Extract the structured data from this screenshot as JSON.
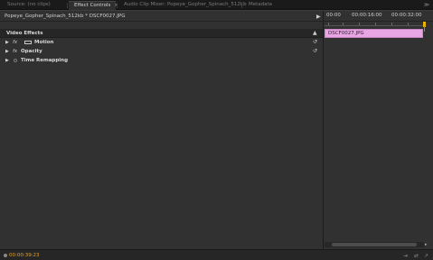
{
  "tabs": [
    {
      "label": "Source: (no clips)",
      "active": false
    },
    {
      "label": "Effect Controls",
      "active": true,
      "close": "×"
    },
    {
      "label": "Audio Clip Mixer: Popeye_Gopher_Spinach_512kb",
      "active": false
    },
    {
      "label": "Metadata",
      "active": false
    }
  ],
  "header": {
    "clip_name": "Popeye_Gopher_Spinach_512kb * DSCF0027.JPG"
  },
  "timeline": {
    "timecodes": [
      "00:00",
      "00:00:16:00",
      "00:00:32:00"
    ],
    "clip_label": "DSCF0027.JPG",
    "clip_color": "#e9a6e5",
    "playhead_color": "#e8b400"
  },
  "effects": {
    "section_title": "Video Effects",
    "items": [
      {
        "name": "Motion",
        "fx": "fx",
        "has_reset": true
      },
      {
        "name": "Opacity",
        "fx": "fx",
        "has_reset": true
      },
      {
        "name": "Time Remapping",
        "fx": "",
        "has_reset": false
      }
    ]
  },
  "footer": {
    "timecode": "00:00:39:23"
  },
  "colors": {
    "accent": "#e0a030",
    "panel_bg": "#313131"
  }
}
